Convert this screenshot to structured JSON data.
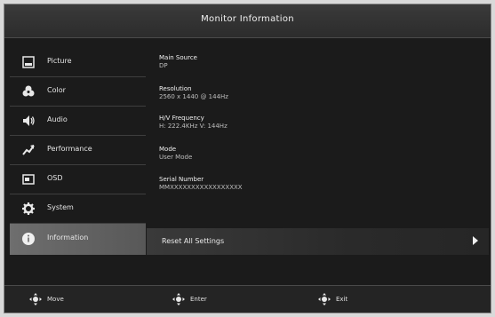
{
  "window": {
    "title": "Monitor Information"
  },
  "sidebar": {
    "items": [
      {
        "label": "Picture",
        "icon": "picture-icon"
      },
      {
        "label": "Color",
        "icon": "color-icon"
      },
      {
        "label": "Audio",
        "icon": "audio-icon"
      },
      {
        "label": "Performance",
        "icon": "performance-icon"
      },
      {
        "label": "OSD",
        "icon": "osd-icon"
      },
      {
        "label": "System",
        "icon": "gear-icon"
      },
      {
        "label": "Information",
        "icon": "info-icon",
        "active": true
      }
    ]
  },
  "info": {
    "fields": [
      {
        "label": "Main Source",
        "value": "DP"
      },
      {
        "label": "Resolution",
        "value": "2560 x 1440 @ 144Hz"
      },
      {
        "label": "H/V Frequency",
        "value": "H: 222.4KHz  V: 144Hz"
      },
      {
        "label": "Mode",
        "value": "User Mode"
      },
      {
        "label": "Serial Number",
        "value": "MMXXXXXXXXXXXXXXXXX"
      }
    ],
    "reset_label": "Reset All Settings"
  },
  "footer": {
    "hints": [
      {
        "label": "Move",
        "icon": "dpad-move-icon"
      },
      {
        "label": "Enter",
        "icon": "dpad-enter-icon"
      },
      {
        "label": "Exit",
        "icon": "dpad-exit-icon"
      }
    ]
  }
}
